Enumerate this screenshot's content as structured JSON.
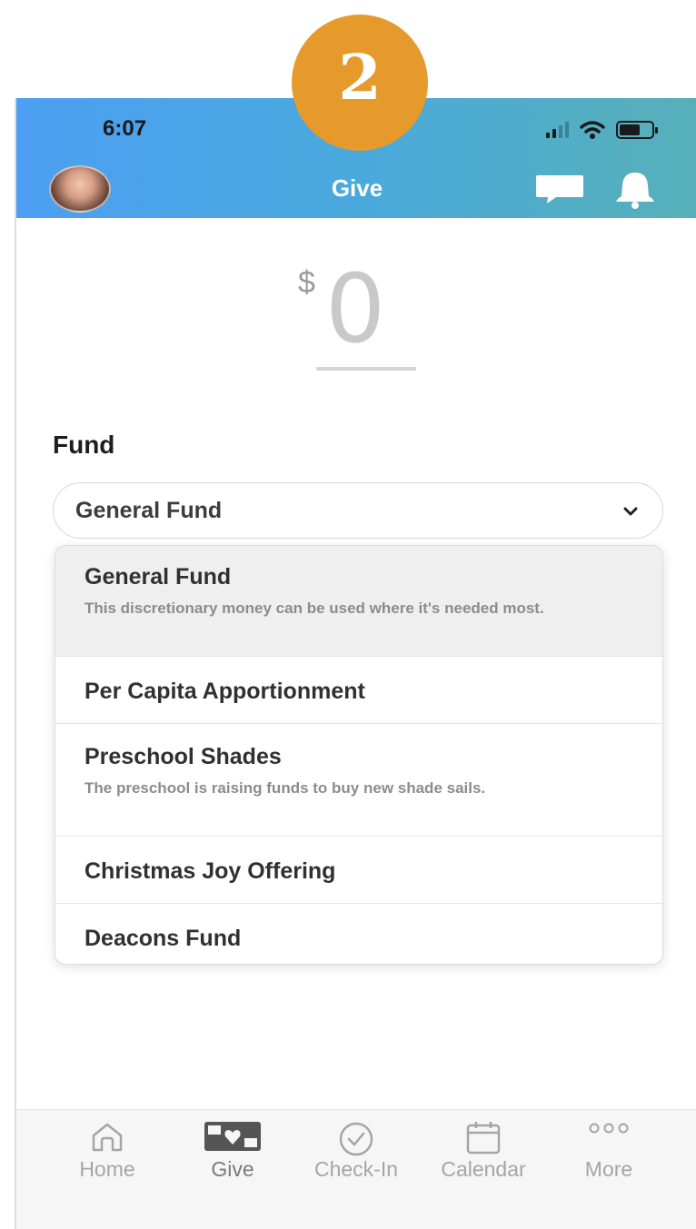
{
  "step_badge": "2",
  "status_bar": {
    "time": "6:07"
  },
  "header": {
    "title": "Give"
  },
  "amount": {
    "currency": "$",
    "value": "0"
  },
  "fund": {
    "label": "Fund",
    "selected": "General Fund",
    "options": [
      {
        "name": "General Fund",
        "description": "This discretionary money can be used where it's needed most.",
        "selected": true
      },
      {
        "name": "Per Capita Apportionment",
        "description": ""
      },
      {
        "name": "Preschool Shades",
        "description": "The preschool is raising funds to buy new shade sails."
      },
      {
        "name": "Christmas Joy Offering",
        "description": ""
      },
      {
        "name": "Deacons Fund",
        "description": ""
      }
    ]
  },
  "nav": {
    "items": [
      {
        "label": "Home",
        "icon": "home-icon"
      },
      {
        "label": "Give",
        "icon": "give-icon",
        "active": true
      },
      {
        "label": "Check-In",
        "icon": "check-in-icon"
      },
      {
        "label": "Calendar",
        "icon": "calendar-icon"
      },
      {
        "label": "More",
        "icon": "more-icon"
      }
    ]
  },
  "colors": {
    "header_start": "#4c9ff2",
    "header_end": "#57b0b8",
    "badge": "#e79a2c"
  }
}
